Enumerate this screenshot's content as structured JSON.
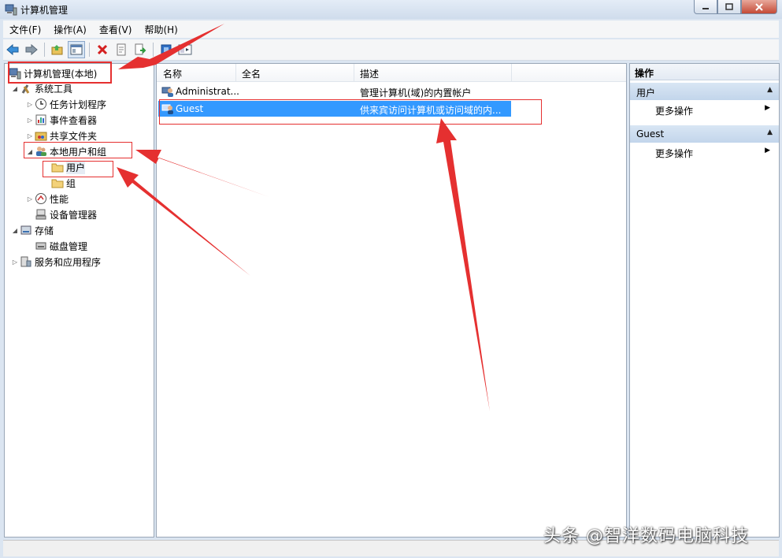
{
  "window": {
    "title": "计算机管理"
  },
  "menu": [
    "文件(F)",
    "操作(A)",
    "查看(V)",
    "帮助(H)"
  ],
  "toolbar": {
    "icons": [
      "back-arrow-icon",
      "forward-arrow-icon",
      "up-folder-icon",
      "show-hide-tree-icon",
      "delete-icon",
      "properties-icon",
      "export-list-icon",
      "help-icon",
      "view-icon"
    ]
  },
  "tree": {
    "root": "计算机管理(本地)",
    "system_tools": "系统工具",
    "task_scheduler": "任务计划程序",
    "event_viewer": "事件查看器",
    "shared_folders": "共享文件夹",
    "local_users": "本地用户和组",
    "users": "用户",
    "groups": "组",
    "performance": "性能",
    "device_manager": "设备管理器",
    "storage": "存储",
    "disk_management": "磁盘管理",
    "services_apps": "服务和应用程序"
  },
  "list": {
    "columns": [
      "名称",
      "全名",
      "描述"
    ],
    "rows": [
      {
        "name": "Administrat...",
        "fullname": "",
        "desc": "管理计算机(域)的内置帐户"
      },
      {
        "name": "Guest",
        "fullname": "",
        "desc": "供来宾访问计算机或访问域的内..."
      }
    ]
  },
  "actions": {
    "header": "操作",
    "sections": [
      {
        "title": "用户",
        "item": "更多操作"
      },
      {
        "title": "Guest",
        "item": "更多操作"
      }
    ]
  },
  "watermark": "头条 @智洋数码电脑科技",
  "colors": {
    "selection": "#3399ff",
    "annotation": "#e53030"
  }
}
